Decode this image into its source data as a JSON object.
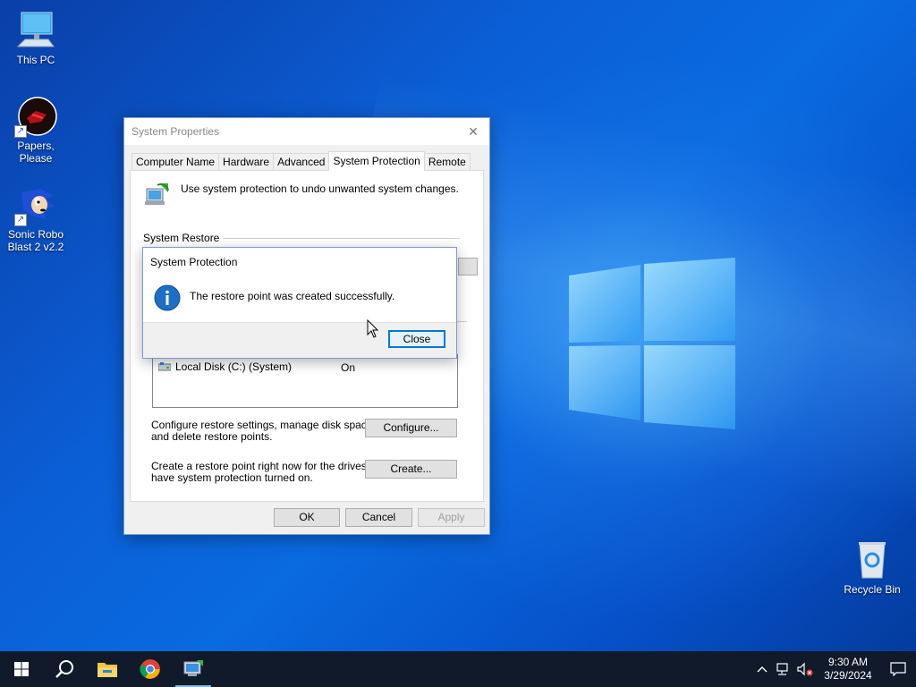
{
  "desktop": {
    "icons": [
      {
        "label": "This PC"
      },
      {
        "label": "Papers, Please"
      },
      {
        "label": "Sonic Robo Blast 2 v2.2"
      },
      {
        "label": "Recycle Bin"
      }
    ]
  },
  "system_properties": {
    "title": "System Properties",
    "tabs": [
      {
        "label": "Computer Name"
      },
      {
        "label": "Hardware"
      },
      {
        "label": "Advanced"
      },
      {
        "label": "System Protection",
        "active": true
      },
      {
        "label": "Remote"
      }
    ],
    "intro": "Use system protection to undo unwanted system changes.",
    "restore_group_label": "System Restore",
    "drive": {
      "name": "Local Disk (C:) (System)",
      "protection": "On"
    },
    "configure_desc_1": "Configure restore settings, manage disk space,",
    "configure_desc_2": "and delete restore points.",
    "configure_button": "Configure...",
    "create_desc_1": "Create a restore point right now for the drives that",
    "create_desc_2": "have system protection turned on.",
    "create_button": "Create...",
    "ok_button": "OK",
    "cancel_button": "Cancel",
    "apply_button": "Apply"
  },
  "message_box": {
    "title": "System Protection",
    "message": "The restore point was created successfully.",
    "close_button": "Close",
    "icon": "info-icon"
  },
  "taskbar": {
    "apps": [
      "start-icon",
      "search-icon",
      "file-explorer-icon",
      "chrome-icon",
      "system-properties-icon"
    ],
    "time": "9:30 AM",
    "date": "3/29/2024"
  },
  "colors": {
    "accent": "#0078d7",
    "taskbar": "#101a2a",
    "desktop": "#0a5fd6"
  }
}
